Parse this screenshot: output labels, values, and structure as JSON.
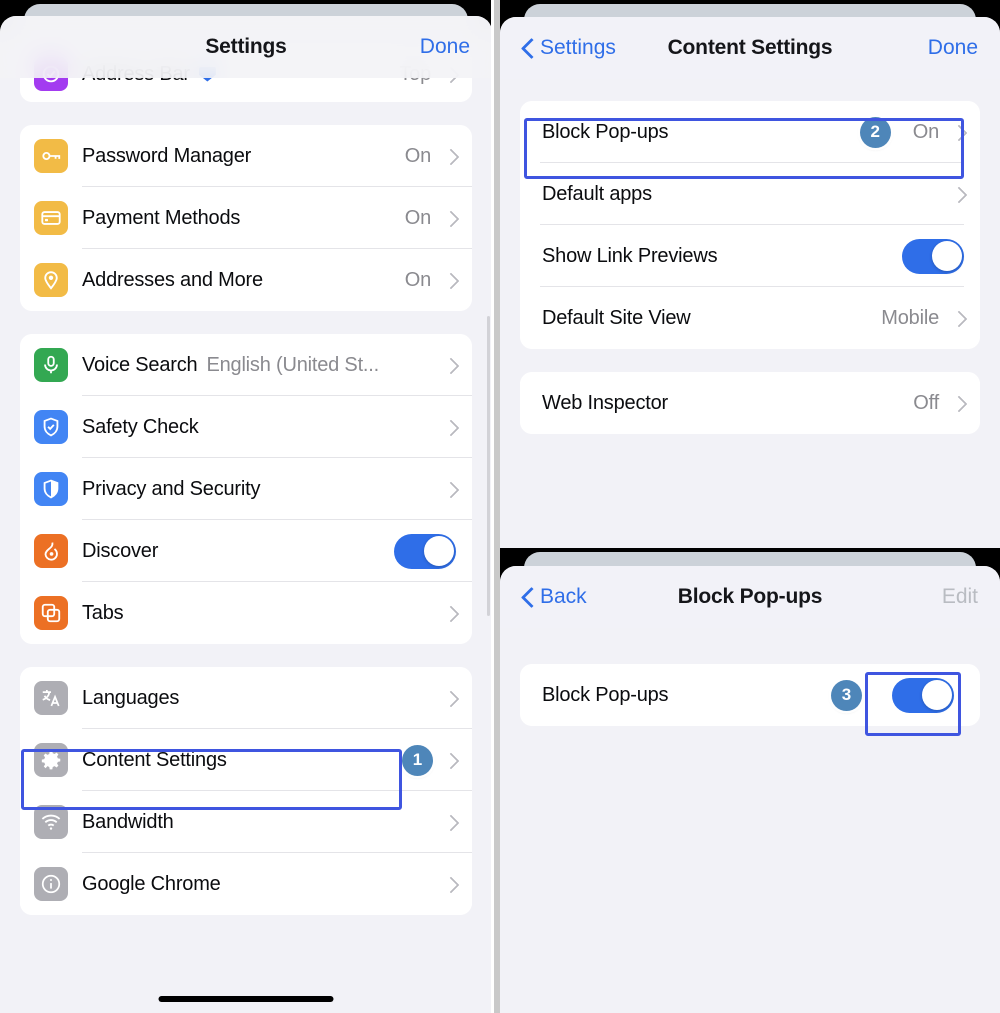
{
  "colors": {
    "accent_blue": "#2f6ee8",
    "highlight_border": "#3f55e0",
    "badge_blue": "#4e86b9",
    "sheet_bg": "#f2f2f7",
    "row_bg": "#ffffff",
    "value_gray": "#8a8a8f"
  },
  "left_panel": {
    "navbar": {
      "title": "Settings",
      "right_action": "Done"
    },
    "groups": [
      {
        "rows": [
          {
            "label": "Address Bar",
            "icon": "address-bar-icon",
            "icon_color": "#a33bf0",
            "value": "Top",
            "chevron": true,
            "has_blue_marker": true
          }
        ]
      },
      {
        "rows": [
          {
            "label": "Password Manager",
            "icon": "key-icon",
            "icon_color": "#f2bb46",
            "value": "On",
            "chevron": true
          },
          {
            "label": "Payment Methods",
            "icon": "credit-card-icon",
            "icon_color": "#f2bb46",
            "value": "On",
            "chevron": true
          },
          {
            "label": "Addresses and More",
            "icon": "location-pin-icon",
            "icon_color": "#f2bb46",
            "value": "On",
            "chevron": true
          }
        ]
      },
      {
        "rows": [
          {
            "label": "Voice Search",
            "icon": "microphone-icon",
            "icon_color": "#33a852",
            "sub": "English (United St...",
            "chevron": true
          },
          {
            "label": "Safety Check",
            "icon": "shield-check-icon",
            "icon_color": "#4285f4",
            "chevron": true
          },
          {
            "label": "Privacy and Security",
            "icon": "shield-half-icon",
            "icon_color": "#4285f4",
            "chevron": true
          },
          {
            "label": "Discover",
            "icon": "flame-icon",
            "icon_color": "#ec7024",
            "toggle": "on"
          },
          {
            "label": "Tabs",
            "icon": "tabs-icon",
            "icon_color": "#ec7024",
            "chevron": true
          }
        ]
      },
      {
        "rows": [
          {
            "label": "Languages",
            "icon": "translate-icon",
            "icon_color": "#aeaeb4",
            "chevron": true
          },
          {
            "label": "Content Settings",
            "icon": "gear-icon",
            "icon_color": "#aeaeb4",
            "chevron": true,
            "badge": "1",
            "highlighted": true
          },
          {
            "label": "Bandwidth",
            "icon": "wifi-icon",
            "icon_color": "#aeaeb4",
            "chevron": true
          },
          {
            "label": "Google Chrome",
            "icon": "info-circle-icon",
            "icon_color": "#aeaeb4",
            "chevron": true
          }
        ]
      }
    ]
  },
  "top_right_panel": {
    "navbar": {
      "back_label": "Settings",
      "title": "Content Settings",
      "right_action": "Done"
    },
    "groups": [
      {
        "rows": [
          {
            "label": "Block Pop-ups",
            "value": "On",
            "chevron": true,
            "badge": "2",
            "highlighted": true
          },
          {
            "label": "Default apps",
            "chevron": true
          },
          {
            "label": "Show Link Previews",
            "toggle": "on"
          },
          {
            "label": "Default Site View",
            "value": "Mobile",
            "chevron": true
          }
        ]
      },
      {
        "rows": [
          {
            "label": "Web Inspector",
            "value": "Off",
            "chevron": true
          }
        ]
      }
    ]
  },
  "bottom_right_panel": {
    "navbar": {
      "back_label": "Back",
      "title": "Block Pop-ups",
      "right_action": "Edit"
    },
    "groups": [
      {
        "rows": [
          {
            "label": "Block Pop-ups",
            "toggle": "on",
            "badge": "3",
            "highlighted_toggle": true
          }
        ]
      }
    ]
  }
}
